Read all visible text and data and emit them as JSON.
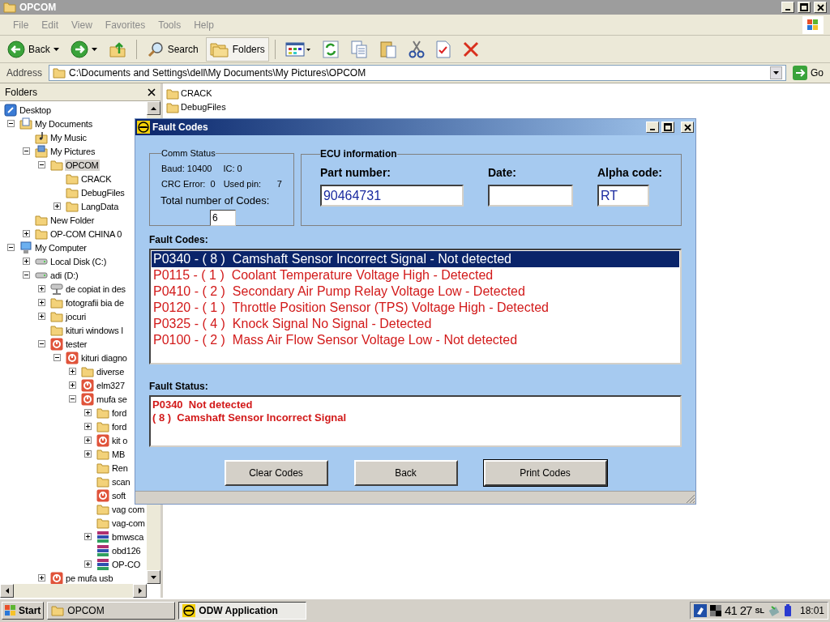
{
  "window": {
    "title": "OPCOM"
  },
  "menu": [
    "File",
    "Edit",
    "View",
    "Favorites",
    "Tools",
    "Help"
  ],
  "toolbar": [
    {
      "kind": "back",
      "label": "Back"
    },
    {
      "kind": "forward"
    },
    {
      "kind": "up"
    },
    {
      "kind": "search",
      "label": "Search",
      "selected": false
    },
    {
      "kind": "folders",
      "label": "Folders",
      "selected": true
    },
    {
      "kind": "views"
    },
    {
      "kind": "refresh"
    },
    {
      "kind": "copy"
    },
    {
      "kind": "paste"
    },
    {
      "kind": "cut"
    },
    {
      "kind": "properties"
    },
    {
      "kind": "delete"
    }
  ],
  "address": {
    "label": "Address",
    "value": "C:\\Documents and Settings\\dell\\My Documents\\My Pictures\\OPCOM",
    "go": "Go"
  },
  "folders_pane": {
    "title": "Folders",
    "tree": [
      {
        "label": "Desktop",
        "kind": "desktop",
        "selected": false,
        "children": [
          {
            "label": "My Documents",
            "kind": "documents",
            "expanded": true,
            "selected": false,
            "children": [
              {
                "label": "My Music",
                "kind": "music",
                "selected": false
              },
              {
                "label": "My Pictures",
                "kind": "pictures",
                "expanded": true,
                "selected": false,
                "children": [
                  {
                    "label": "OPCOM",
                    "kind": "folder",
                    "expanded": true,
                    "selected": true,
                    "children": [
                      {
                        "label": "CRACK",
                        "kind": "folder",
                        "selected": false
                      },
                      {
                        "label": "DebugFiles",
                        "kind": "folder",
                        "selected": false
                      },
                      {
                        "label": "LangData",
                        "kind": "folder",
                        "expanded": false,
                        "selected": false
                      }
                    ]
                  }
                ]
              },
              {
                "label": "New Folder",
                "kind": "folder",
                "selected": false
              },
              {
                "label": "OP-COM CHINA 0",
                "kind": "folder",
                "expanded": false,
                "selected": false
              }
            ]
          },
          {
            "label": "My Computer",
            "kind": "computer",
            "expanded": true,
            "selected": false,
            "children": [
              {
                "label": "Local Disk (C:)",
                "kind": "drive",
                "expanded": false,
                "selected": false
              },
              {
                "label": "adi (D:)",
                "kind": "drive",
                "expanded": true,
                "selected": false,
                "children": [
                  {
                    "label": "de copiat in des",
                    "kind": "network",
                    "expanded": false,
                    "selected": false
                  },
                  {
                    "label": "fotografii bia de",
                    "kind": "folder",
                    "expanded": false,
                    "selected": false
                  },
                  {
                    "label": "jocuri",
                    "kind": "folder",
                    "expanded": false,
                    "selected": false
                  },
                  {
                    "label": "kituri windows l",
                    "kind": "folder",
                    "selected": false
                  },
                  {
                    "label": "tester",
                    "kind": "app",
                    "expanded": true,
                    "selected": false,
                    "children": [
                      {
                        "label": "kituri diagno",
                        "kind": "app",
                        "expanded": true,
                        "selected": false,
                        "children": [
                          {
                            "label": "diverse",
                            "kind": "folder",
                            "expanded": false,
                            "selected": false
                          },
                          {
                            "label": "elm327",
                            "kind": "app",
                            "expanded": false,
                            "selected": false
                          },
                          {
                            "label": "mufa se",
                            "kind": "app",
                            "expanded": true,
                            "selected": false,
                            "children": [
                              {
                                "label": "ford",
                                "kind": "folder",
                                "expanded": false,
                                "selected": false
                              },
                              {
                                "label": "ford",
                                "kind": "folder",
                                "expanded": false,
                                "selected": false
                              },
                              {
                                "label": "kit o",
                                "kind": "app",
                                "expanded": false,
                                "selected": false
                              },
                              {
                                "label": "MB",
                                "kind": "folder",
                                "expanded": false,
                                "selected": false
                              },
                              {
                                "label": "Ren",
                                "kind": "folder",
                                "selected": false
                              },
                              {
                                "label": "scan",
                                "kind": "folder",
                                "selected": false
                              },
                              {
                                "label": "soft",
                                "kind": "app",
                                "selected": false
                              },
                              {
                                "label": "vag com",
                                "kind": "folder",
                                "selected": false
                              },
                              {
                                "label": "vag-com",
                                "kind": "folder",
                                "selected": false
                              },
                              {
                                "label": "bmwsca",
                                "kind": "archive",
                                "expanded": false,
                                "selected": false
                              },
                              {
                                "label": "obd126",
                                "kind": "archive",
                                "selected": false
                              },
                              {
                                "label": "OP-CO",
                                "kind": "archive",
                                "expanded": false,
                                "selected": false
                              }
                            ]
                          }
                        ]
                      }
                    ]
                  },
                  {
                    "label": "pe mufa usb",
                    "kind": "app",
                    "expanded": false,
                    "selected": false
                  }
                ]
              }
            ]
          }
        ]
      }
    ]
  },
  "files": [
    {
      "name": "CRACK"
    },
    {
      "name": "DebugFiles"
    }
  ],
  "dialog": {
    "title": "Fault Codes",
    "comm_status": {
      "title": "Comm Status",
      "baud": "Baud: 10400",
      "ic": "IC: 0",
      "crc": "CRC Error:  0",
      "used_pin_label": "Used pin:",
      "used_pin": "7",
      "total_label": "Total number of Codes:",
      "total": "6"
    },
    "ecu": {
      "title": "ECU information",
      "fields": [
        {
          "label": "Part number:",
          "value": "90464731"
        },
        {
          "label": "Date:"
        },
        {
          "label": "Alpha code:",
          "value": "RT"
        }
      ]
    },
    "fault_codes_label": "Fault Codes:",
    "fault_codes": [
      {
        "text": "P0340 - ( 8 )  Camshaft Sensor Incorrect Signal - Not detected",
        "selected": true
      },
      {
        "text": "P0115 - ( 1 )  Coolant Temperature Voltage High - Detected",
        "selected": false
      },
      {
        "text": "P0410 - ( 2 )  Secondary Air Pump Relay Voltage Low - Detected",
        "selected": false
      },
      {
        "text": "P0120 - ( 1 )  Throttle Position Sensor (TPS) Voltage High - Detected",
        "selected": false
      },
      {
        "text": "P0325 - ( 4 )  Knock Signal No Signal - Detected",
        "selected": false
      },
      {
        "text": "P0100 - ( 2 )  Mass Air Flow Sensor Voltage Low - Not detected",
        "selected": false
      }
    ],
    "fault_status_label": "Fault Status:",
    "fault_status": [
      "P0340  Not detected",
      "( 8 )  Camshaft Sensor Incorrect Signal"
    ],
    "buttons": [
      {
        "label": "Clear Codes",
        "focused": false
      },
      {
        "label": "Back",
        "focused": false
      },
      {
        "label": "Print Codes",
        "focused": true
      }
    ]
  },
  "taskbar": {
    "start": "Start",
    "tasks": [
      {
        "label": "OPCOM",
        "kind": "folder",
        "selected": false
      },
      {
        "label": "ODW Application",
        "kind": "opel",
        "selected": true
      }
    ],
    "tray": [
      "41",
      "27",
      "SL"
    ],
    "clock": "18:01"
  }
}
